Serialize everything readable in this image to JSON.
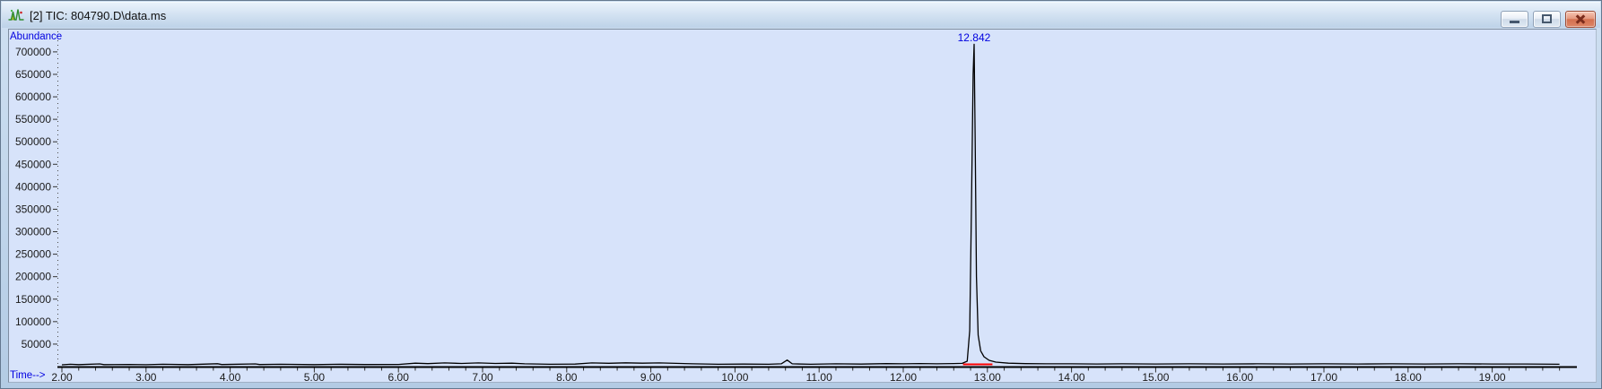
{
  "window": {
    "title": "[2] TIC: 804790.D\\data.ms",
    "icon": "chromatogram-icon",
    "buttons": {
      "minimize": "minimize",
      "maximize": "maximize",
      "close": "close"
    }
  },
  "colors": {
    "plot_bg": "#d7e3fa",
    "trace": "#000000",
    "integration": "#ff0000",
    "annotation_blue": "#0000e0",
    "axis_text": "#1a1a1a",
    "close_button_red": "#d4704f"
  },
  "chart_data": {
    "type": "line",
    "title": "TIC: 804790.D\\data.ms",
    "ylabel": "Abundance",
    "xlabel": "Time-->",
    "xlim": [
      1.95,
      20.05
    ],
    "ylim": [
      0,
      750000
    ],
    "grid": false,
    "legend": false,
    "x_major_ticks": [
      2,
      3,
      4,
      5,
      6,
      7,
      8,
      9,
      10,
      11,
      12,
      13,
      14,
      15,
      16,
      17,
      18,
      19
    ],
    "x_tick_labels": [
      "2.00",
      "3.00",
      "4.00",
      "5.00",
      "6.00",
      "7.00",
      "8.00",
      "9.00",
      "10.00",
      "11.00",
      "12.00",
      "13.00",
      "14.00",
      "15.00",
      "16.00",
      "17.00",
      "18.00",
      "19.00"
    ],
    "x_minor_step": 0.2,
    "y_major_ticks": [
      50000,
      100000,
      150000,
      200000,
      250000,
      300000,
      350000,
      400000,
      450000,
      500000,
      550000,
      600000,
      650000,
      700000
    ],
    "y_tick_labels": [
      "50000",
      "100000",
      "150000",
      "200000",
      "250000",
      "300000",
      "350000",
      "400000",
      "450000",
      "500000",
      "550000",
      "600000",
      "650000",
      "700000"
    ],
    "peak_labels": [
      {
        "x": 12.842,
        "label": "12.842",
        "color": "#0000e0"
      }
    ],
    "integration_baselines": [
      {
        "x_start": 12.71,
        "x_end": 13.06,
        "color": "#ff0000"
      }
    ],
    "series": [
      {
        "name": "TIC",
        "color": "#000000",
        "points": [
          [
            2.0,
            4000
          ],
          [
            2.1,
            5200
          ],
          [
            2.2,
            4300
          ],
          [
            2.45,
            6000
          ],
          [
            2.5,
            4400
          ],
          [
            2.8,
            4800
          ],
          [
            3.0,
            4200
          ],
          [
            3.2,
            5200
          ],
          [
            3.5,
            4300
          ],
          [
            3.85,
            6300
          ],
          [
            3.9,
            4600
          ],
          [
            4.3,
            6000
          ],
          [
            4.35,
            4500
          ],
          [
            4.6,
            5200
          ],
          [
            5.0,
            4300
          ],
          [
            5.3,
            5200
          ],
          [
            5.6,
            4600
          ],
          [
            6.0,
            4800
          ],
          [
            6.2,
            7600
          ],
          [
            6.35,
            6600
          ],
          [
            6.55,
            8200
          ],
          [
            6.75,
            7000
          ],
          [
            6.95,
            8200
          ],
          [
            7.15,
            7000
          ],
          [
            7.35,
            7600
          ],
          [
            7.5,
            6200
          ],
          [
            7.8,
            5200
          ],
          [
            8.1,
            5600
          ],
          [
            8.3,
            8200
          ],
          [
            8.5,
            7300
          ],
          [
            8.7,
            8400
          ],
          [
            8.9,
            7500
          ],
          [
            9.1,
            8200
          ],
          [
            9.3,
            7100
          ],
          [
            9.5,
            6100
          ],
          [
            9.8,
            5200
          ],
          [
            10.1,
            5600
          ],
          [
            10.4,
            5100
          ],
          [
            10.55,
            6200
          ],
          [
            10.62,
            14500
          ],
          [
            10.68,
            6200
          ],
          [
            10.9,
            5200
          ],
          [
            11.2,
            6200
          ],
          [
            11.5,
            5600
          ],
          [
            11.8,
            6600
          ],
          [
            12.0,
            6200
          ],
          [
            12.2,
            6700
          ],
          [
            12.4,
            6200
          ],
          [
            12.6,
            6700
          ],
          [
            12.7,
            7200
          ],
          [
            12.76,
            12000
          ],
          [
            12.79,
            80000
          ],
          [
            12.81,
            350000
          ],
          [
            12.83,
            650000
          ],
          [
            12.842,
            717000
          ],
          [
            12.855,
            500000
          ],
          [
            12.87,
            200000
          ],
          [
            12.89,
            70000
          ],
          [
            12.92,
            35000
          ],
          [
            12.96,
            22000
          ],
          [
            13.02,
            14000
          ],
          [
            13.1,
            10000
          ],
          [
            13.25,
            7600
          ],
          [
            13.45,
            6600
          ],
          [
            13.7,
            6200
          ],
          [
            14.0,
            6200
          ],
          [
            14.3,
            5700
          ],
          [
            14.6,
            6200
          ],
          [
            15.0,
            5700
          ],
          [
            15.4,
            6200
          ],
          [
            15.8,
            5700
          ],
          [
            16.2,
            6200
          ],
          [
            16.6,
            5700
          ],
          [
            17.0,
            6200
          ],
          [
            17.4,
            5700
          ],
          [
            17.8,
            6200
          ],
          [
            18.2,
            5700
          ],
          [
            18.6,
            6200
          ],
          [
            19.0,
            5700
          ],
          [
            19.4,
            5700
          ],
          [
            19.8,
            5200
          ]
        ]
      }
    ]
  }
}
